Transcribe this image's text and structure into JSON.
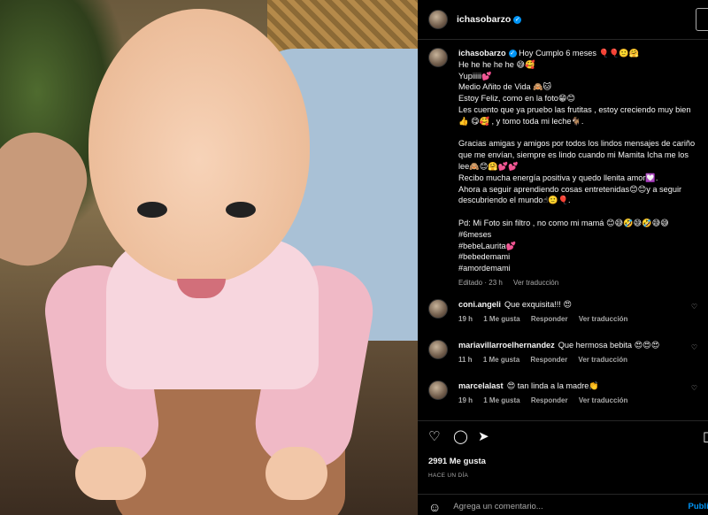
{
  "post": {
    "username": "ichasobarzo",
    "caption_lines": [
      "Hoy Cumplo 6 meses 🎈🎈🙂🤗",
      "He he he he he 😅🥰",
      "Yupiiiii💕",
      "Medio Añito de Vida 🙈🐱",
      "Estoy Feliz, como en la foto😁😊",
      "Les cuento que ya pruebo las frutitas , estoy creciendo muy bien",
      "👍 😋🥰 , y tomo toda mi leche🐐.",
      "",
      "Gracias amigas y amigos por todos los lindos mensajes de cariño",
      "que me envían, siempre es lindo cuando mi Mamita Icha me los",
      "lee🙈😊🤗💕💕",
      "Recibo mucha energía positiva y quedo llenita amor💟.",
      "Ahora a seguir aprendiendo cosas entretenidas😊😊y a seguir",
      "descubriendo el mundo☝🙂🎈.",
      "",
      "Pd: Mi Foto sin filtro , no como mi mamá 😊😅🤣😅🤣😅😅",
      "#6meses",
      "#bebeLaurita💕",
      "#bebedemami",
      "#amordemami"
    ],
    "edited": "Editado · 23 h",
    "see_translation": "Ver traducción",
    "likes": "2991 Me gusta",
    "time_ago": "HACE UN DÍA",
    "add_comment_placeholder": "Agrega un comentario...",
    "publish": "Public"
  },
  "comments": [
    {
      "user": "coni.angeli",
      "text": "Que exquisita!!! 😍",
      "time": "19 h",
      "likes": "1 Me gusta",
      "reply": "Responder",
      "translate": "Ver traducción"
    },
    {
      "user": "mariavillarroelhernandez",
      "text": "Que hermosa bebita 😍😍😍",
      "time": "11 h",
      "likes": "1 Me gusta",
      "reply": "Responder",
      "translate": "Ver traducción"
    },
    {
      "user": "marcelalast",
      "text": "😍 tan linda a la madre👏",
      "time": "19 h",
      "likes": "1 Me gusta",
      "reply": "Responder",
      "translate": "Ver traducción"
    }
  ],
  "icons": {
    "like": "heart-icon",
    "comment": "comment-icon",
    "share": "share-icon",
    "save": "bookmark-icon",
    "emoji": "emoji-icon",
    "verified": "verified-badge-icon"
  },
  "colors": {
    "accent": "#0095f6",
    "muted": "#a8a8a8",
    "background": "#000000"
  }
}
